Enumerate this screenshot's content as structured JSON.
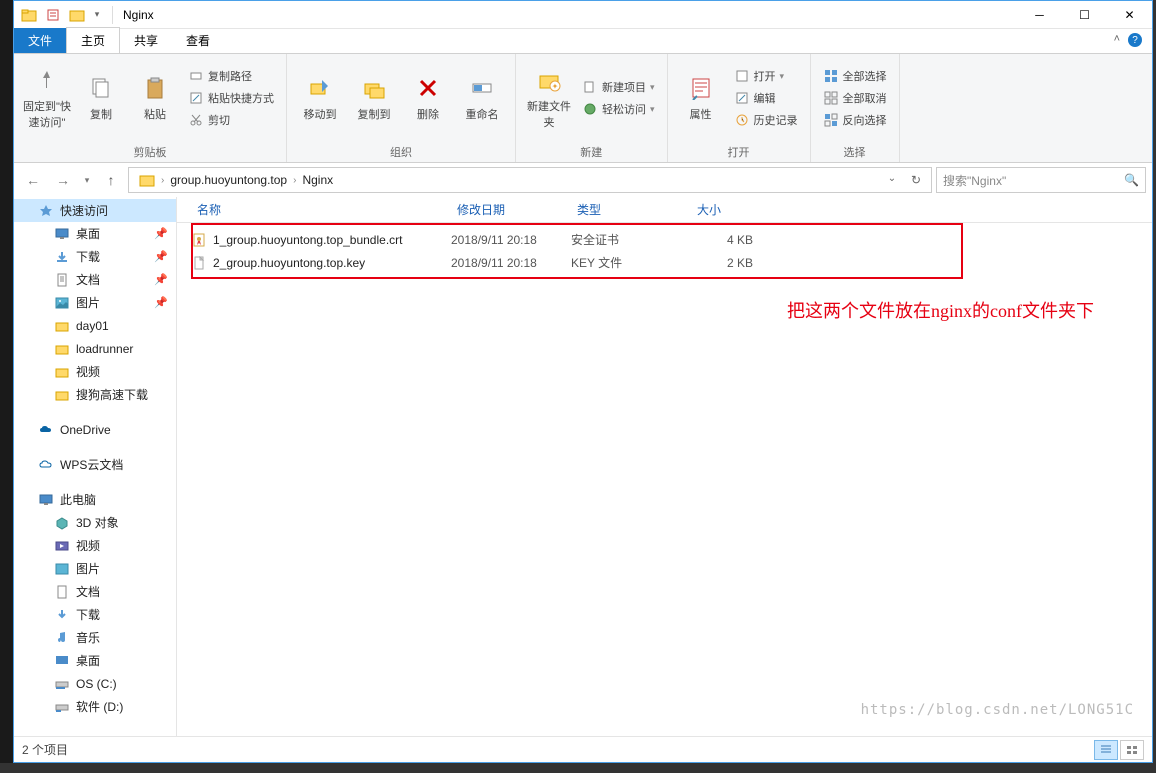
{
  "title": "Nginx",
  "tabs": {
    "file": "文件",
    "home": "主页",
    "share": "共享",
    "view": "查看"
  },
  "ribbon": {
    "clipboard": {
      "label": "剪贴板",
      "pin": "固定到\"快速访问\"",
      "copy": "复制",
      "paste": "粘贴",
      "copy_path": "复制路径",
      "paste_shortcut": "粘贴快捷方式",
      "cut": "剪切"
    },
    "organize": {
      "label": "组织",
      "move_to": "移动到",
      "copy_to": "复制到",
      "delete": "删除",
      "rename": "重命名"
    },
    "new": {
      "label": "新建",
      "new_folder": "新建文件夹",
      "new_item": "新建项目",
      "easy_access": "轻松访问"
    },
    "open": {
      "label": "打开",
      "properties": "属性",
      "open_btn": "打开",
      "edit": "编辑",
      "history": "历史记录"
    },
    "select": {
      "label": "选择",
      "select_all": "全部选择",
      "select_none": "全部取消",
      "invert": "反向选择"
    }
  },
  "breadcrumbs": [
    "group.huoyuntong.top",
    "Nginx"
  ],
  "search_placeholder": "搜索\"Nginx\"",
  "columns": {
    "name": "名称",
    "date": "修改日期",
    "type": "类型",
    "size": "大小"
  },
  "files": [
    {
      "name": "1_group.huoyuntong.top_bundle.crt",
      "date": "2018/9/11 20:18",
      "type": "安全证书",
      "size": "4 KB",
      "icon": "cert"
    },
    {
      "name": "2_group.huoyuntong.top.key",
      "date": "2018/9/11 20:18",
      "type": "KEY 文件",
      "size": "2 KB",
      "icon": "file"
    }
  ],
  "sidebar": {
    "quick_access": "快速访问",
    "desktop": "桌面",
    "downloads": "下载",
    "documents": "文档",
    "pictures": "图片",
    "day01": "day01",
    "loadrunner": "loadrunner",
    "videos_q": "视频",
    "sogou": "搜狗高速下载",
    "onedrive": "OneDrive",
    "wps": "WPS云文档",
    "this_pc": "此电脑",
    "objects3d": "3D 对象",
    "videos": "视频",
    "pictures2": "图片",
    "documents2": "文档",
    "downloads2": "下载",
    "music": "音乐",
    "desktop2": "桌面",
    "os_c": "OS (C:)",
    "soft_d": "软件 (D:)"
  },
  "status": "2 个项目",
  "annotation": "把这两个文件放在nginx的conf文件夹下",
  "watermark": "https://blog.csdn.net/LONG51C"
}
